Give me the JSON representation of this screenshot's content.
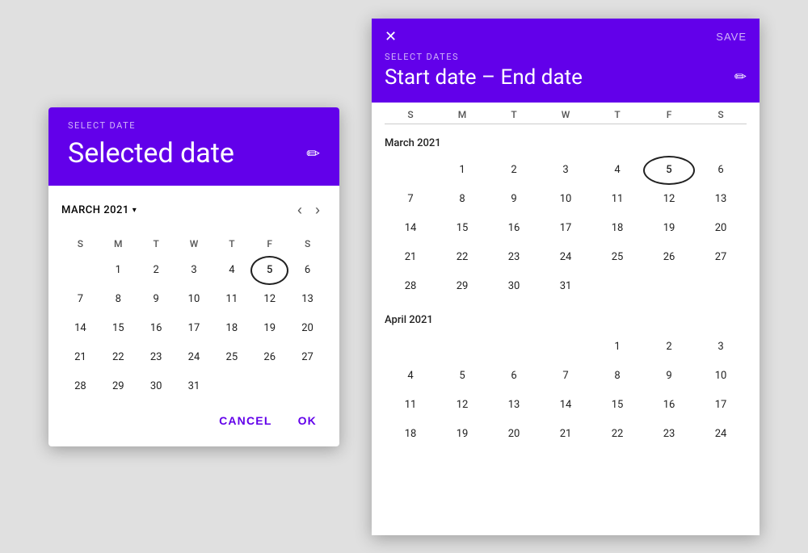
{
  "left_dialog": {
    "header_label": "SELECT DATE",
    "header_title": "Selected date",
    "month_label": "MARCH 2021",
    "edit_icon": "✏",
    "dropdown_icon": "▾",
    "prev_icon": "‹",
    "next_icon": "›",
    "day_headers": [
      "S",
      "M",
      "T",
      "W",
      "T",
      "F",
      "S"
    ],
    "weeks": [
      [
        "",
        "1",
        "2",
        "3",
        "4",
        "5",
        "6"
      ],
      [
        "7",
        "8",
        "9",
        "10",
        "11",
        "12",
        "13"
      ],
      [
        "14",
        "15",
        "16",
        "17",
        "18",
        "19",
        "20"
      ],
      [
        "21",
        "22",
        "23",
        "24",
        "25",
        "26",
        "27"
      ],
      [
        "28",
        "29",
        "30",
        "31",
        "",
        "",
        ""
      ]
    ],
    "selected_day": "5",
    "cancel_label": "CANCEL",
    "ok_label": "OK"
  },
  "right_dialog": {
    "header_label": "SELECT DATES",
    "header_title": "Start date – End date",
    "close_icon": "✕",
    "save_label": "SAVE",
    "edit_icon": "✏",
    "weekday_headers": [
      "S",
      "M",
      "T",
      "W",
      "T",
      "F",
      "S"
    ],
    "months": [
      {
        "label": "March 2021",
        "weeks": [
          [
            "",
            "1",
            "2",
            "3",
            "4",
            "5",
            "6"
          ],
          [
            "7",
            "8",
            "9",
            "10",
            "11",
            "12",
            "13"
          ],
          [
            "14",
            "15",
            "16",
            "17",
            "18",
            "19",
            "20"
          ],
          [
            "21",
            "22",
            "23",
            "24",
            "25",
            "26",
            "27"
          ],
          [
            "28",
            "29",
            "30",
            "31",
            "",
            "",
            ""
          ]
        ],
        "selected_day": "5"
      },
      {
        "label": "April 2021",
        "weeks": [
          [
            "",
            "",
            "",
            "",
            "1",
            "2",
            "3"
          ],
          [
            "4",
            "5",
            "6",
            "7",
            "8",
            "9",
            "10"
          ],
          [
            "11",
            "12",
            "13",
            "14",
            "15",
            "16",
            "17"
          ],
          [
            "18",
            "19",
            "20",
            "21",
            "22",
            "23",
            "24"
          ]
        ],
        "selected_day": ""
      }
    ]
  },
  "colors": {
    "purple": "#6200ea"
  }
}
